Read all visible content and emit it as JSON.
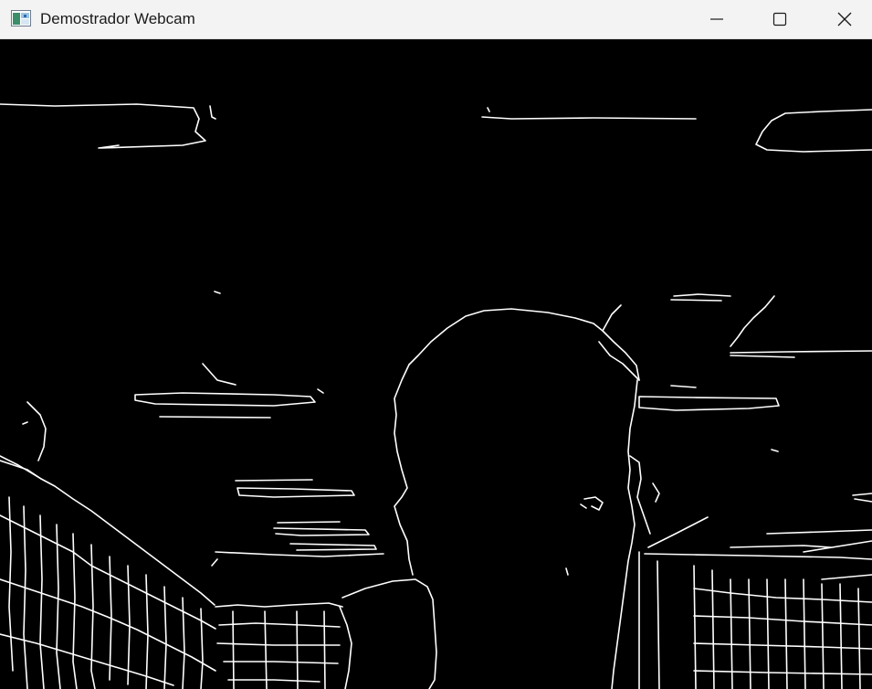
{
  "window": {
    "title": "Demostrador Webcam",
    "icon": "app-window-icon",
    "controls": {
      "minimize_icon": "minimize-icon",
      "maximize_icon": "maximize-icon",
      "close_icon": "close-icon"
    }
  },
  "content": {
    "description_icon": "edge-detection-frame",
    "colors": {
      "background": "#000000",
      "edges": "#ffffff"
    }
  }
}
